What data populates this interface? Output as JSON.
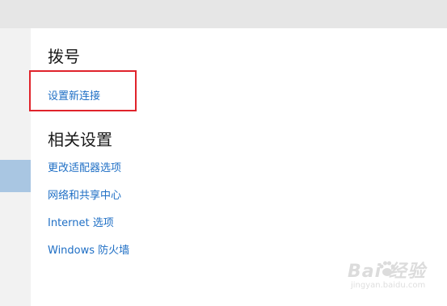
{
  "dialup": {
    "heading": "拨号",
    "setup_link": "设置新连接"
  },
  "related": {
    "heading": "相关设置",
    "links": [
      "更改适配器选项",
      "网络和共享中心",
      "Internet 选项",
      "Windows 防火墙"
    ]
  },
  "colors": {
    "link": "#1f6fc5",
    "highlight_box": "#e0232b",
    "sidebar_selected": "#a9c6e2"
  },
  "watermark": {
    "brand": "Bai 经验",
    "url": "jingyan.baidu.com"
  }
}
